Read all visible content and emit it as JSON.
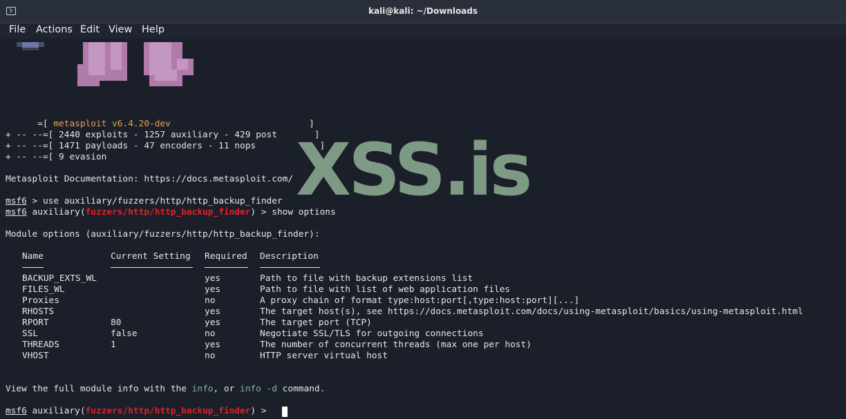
{
  "window": {
    "title": "kali@kali: ~/Downloads"
  },
  "menu": [
    "File",
    "Actions",
    "Edit",
    "View",
    "Help"
  ],
  "banner": {
    "line1_prefix": "      =[ ",
    "version": "metasploit v6.4.20-dev",
    "line1_suffix": "                          ]",
    "line2": "+ -- --=[ 2440 exploits - 1257 auxiliary - 429 post       ]",
    "line3": "+ -- --=[ 1471 payloads - 47 encoders - 11 nops            ]",
    "line4": "+ -- --=[ 9 evasion                                       ]"
  },
  "docs_line": "Metasploit Documentation: https://docs.metasploit.com/",
  "prompt": "msf6",
  "cmd1": " > use auxiliary/fuzzers/http/http_backup_finder",
  "cmd2_prefix": " auxiliary(",
  "module_path": "fuzzers/http/http_backup_finder",
  "cmd2_suffix": ") > show options",
  "module_options_line": "Module options (auxiliary/fuzzers/http/http_backup_finder):",
  "table": {
    "headers": [
      "Name",
      "Current Setting",
      "Required",
      "Description"
    ],
    "rows": [
      [
        "BACKUP_EXTS_WL",
        "",
        "yes",
        "Path to file with backup extensions list"
      ],
      [
        "FILES_WL",
        "",
        "yes",
        "Path to file with list of web application files"
      ],
      [
        "Proxies",
        "",
        "no",
        "A proxy chain of format type:host:port[,type:host:port][...]"
      ],
      [
        "RHOSTS",
        "",
        "yes",
        "The target host(s), see https://docs.metasploit.com/docs/using-metasploit/basics/using-metasploit.html"
      ],
      [
        "RPORT",
        "80",
        "yes",
        "The target port (TCP)"
      ],
      [
        "SSL",
        "false",
        "no",
        "Negotiate SSL/TLS for outgoing connections"
      ],
      [
        "THREADS",
        "1",
        "yes",
        "The number of concurrent threads (max one per host)"
      ],
      [
        "VHOST",
        "",
        "no",
        "HTTP server virtual host"
      ]
    ]
  },
  "info_line": {
    "part1": "View the full module info with the ",
    "link1": "info",
    "part2": ", or ",
    "link2": "info -d",
    "part3": " command."
  },
  "final_prompt_prefix": " auxiliary(",
  "final_prompt_suffix": ") > ",
  "watermark": "XSS.is"
}
